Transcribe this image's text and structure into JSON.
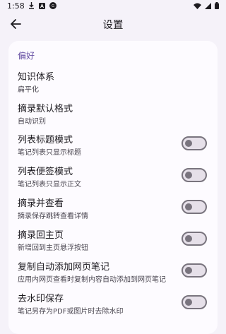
{
  "status_bar": {
    "time": "1:58",
    "left_icons": [
      "download-icon",
      "a-icon",
      "notification-icon"
    ],
    "right_icons": [
      "wifi-icon",
      "signal-icon",
      "battery-icon"
    ]
  },
  "app_bar": {
    "title": "设置",
    "back_icon": "arrow-back-icon"
  },
  "section": {
    "title": "偏好"
  },
  "items": [
    {
      "title": "知识体系",
      "subtitle": "扁平化",
      "has_switch": false
    },
    {
      "title": "摘录默认格式",
      "subtitle": "自动识别",
      "has_switch": false
    },
    {
      "title": "列表标题模式",
      "subtitle": "笔记列表只显示标题",
      "has_switch": true,
      "on": false
    },
    {
      "title": "列表便签模式",
      "subtitle": "笔记列表只显示正文",
      "has_switch": true,
      "on": false
    },
    {
      "title": "摘录并查看",
      "subtitle": "摘录保存跳转查看详情",
      "has_switch": true,
      "on": false
    },
    {
      "title": "摘录回主页",
      "subtitle": "新增回到主页悬浮按钮",
      "has_switch": true,
      "on": false
    },
    {
      "title": "复制自动添加网页笔记",
      "subtitle": "应用内网页查看时复制内容自动添加到网页笔记",
      "has_switch": true,
      "on": false
    },
    {
      "title": "去水印保存",
      "subtitle": "笔记另存为PDF或图片时去除水印",
      "has_switch": true,
      "on": false
    }
  ],
  "colors": {
    "accent": "#6750a4",
    "background": "#f5f2f9",
    "card": "#fdfbff",
    "switch_off": "#79747e"
  }
}
